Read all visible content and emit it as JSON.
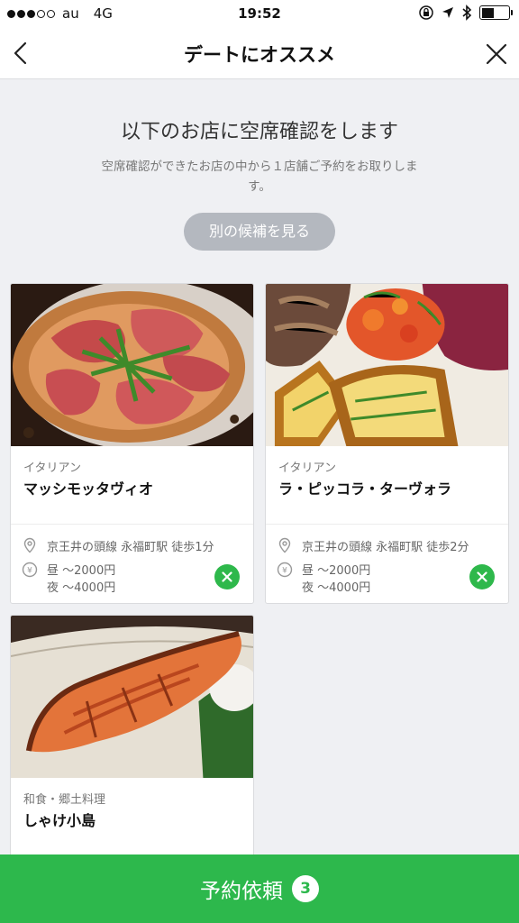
{
  "status_bar": {
    "carrier": "au",
    "network": "4G",
    "time": "19:52",
    "signal_filled": 3,
    "signal_total": 5
  },
  "header": {
    "title": "デートにオススメ",
    "back_icon": "chevron-left-icon",
    "close_icon": "close-icon"
  },
  "intro": {
    "heading": "以下のお店に空席確認をします",
    "subtext": "空席確認ができたお店の中から１店舗ご予約をお取りします。",
    "alt_button": "別の候補を見る"
  },
  "restaurants": [
    {
      "photo": "pizza-photo",
      "genre": "イタリアン",
      "name": "マッシモッタヴィオ",
      "location": "京王井の頭線 永福町駅 徒歩1分",
      "price_lunch": "昼 〜2000円",
      "price_dinner": "夜 〜4000円"
    },
    {
      "photo": "antipasto-photo",
      "genre": "イタリアン",
      "name": "ラ・ピッコラ・ターヴォラ",
      "location": "京王井の頭線 永福町駅 徒歩2分",
      "price_lunch": "昼 〜2000円",
      "price_dinner": "夜 〜4000円"
    },
    {
      "photo": "grilled-salmon-photo",
      "genre": "和食・郷土料理",
      "name": "しゃけ小島"
    }
  ],
  "cta": {
    "label": "予約依頼",
    "count": "3"
  },
  "colors": {
    "accent_green": "#2db84c",
    "background": "#eff0f3",
    "gray_button": "#b4b8bf"
  }
}
